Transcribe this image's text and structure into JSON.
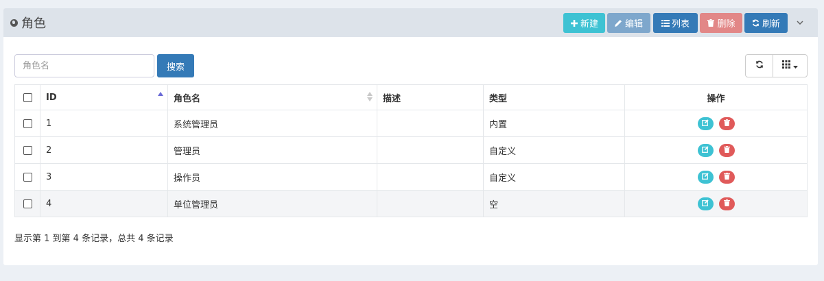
{
  "header": {
    "title": "角色",
    "buttons": {
      "new": "新建",
      "edit": "编辑",
      "list": "列表",
      "delete": "删除",
      "refresh": "刷新"
    }
  },
  "search": {
    "placeholder": "角色名",
    "value": "",
    "button": "搜索"
  },
  "table": {
    "columns": [
      "ID",
      "角色名",
      "描述",
      "类型",
      "操作"
    ],
    "rows": [
      {
        "id": "1",
        "name": "系统管理员",
        "desc": "",
        "type": "内置"
      },
      {
        "id": "2",
        "name": "管理员",
        "desc": "",
        "type": "自定义"
      },
      {
        "id": "3",
        "name": "操作员",
        "desc": "",
        "type": "自定义"
      },
      {
        "id": "4",
        "name": "单位管理员",
        "desc": "",
        "type": "空"
      }
    ]
  },
  "footer": {
    "summary": "显示第 1 到第 4 条记录，总共 4 条记录"
  },
  "colors": {
    "accent_teal": "#3ec2d3",
    "primary_blue": "#347ab7",
    "danger_red": "#e05a5a",
    "sort_active": "#6b6bd6"
  },
  "icons": {
    "title": "globe-icon",
    "new": "plus-icon",
    "edit": "pencil-icon",
    "list": "list-icon",
    "delete": "trash-icon",
    "refresh": "refresh-icon",
    "collapse": "chevron-down-icon",
    "columns": "grid-icon"
  }
}
